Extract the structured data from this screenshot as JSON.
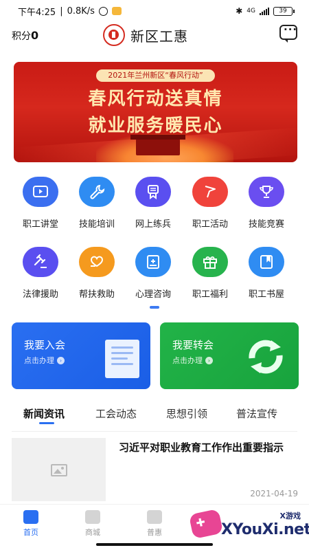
{
  "status_bar": {
    "time": "下午4:25",
    "speed": "0.8K/s",
    "network": "4G",
    "battery": "39"
  },
  "header": {
    "points_label": "积分",
    "points_value": "0",
    "title": "新区工惠"
  },
  "banner": {
    "tag": "2021年兰州新区“春风行动”",
    "line1": "春风行动送真情",
    "line2": "就业服务暖民心"
  },
  "grid": {
    "row1": [
      {
        "label": "职工讲堂",
        "icon": "video-play-icon",
        "color": "#3b6ff0"
      },
      {
        "label": "技能培训",
        "icon": "wrench-icon",
        "color": "#2f8cf2"
      },
      {
        "label": "网上练兵",
        "icon": "medal-icon",
        "color": "#5a4ff0"
      },
      {
        "label": "职工活动",
        "icon": "flag-icon",
        "color": "#f0433b"
      },
      {
        "label": "技能竞赛",
        "icon": "trophy-icon",
        "color": "#6a4ef0"
      }
    ],
    "row2": [
      {
        "label": "法律援助",
        "icon": "gavel-icon",
        "color": "#5a4ff0"
      },
      {
        "label": "帮扶救助",
        "icon": "heart-hand-icon",
        "color": "#f59a1e"
      },
      {
        "label": "心理咨询",
        "icon": "book-plus-icon",
        "color": "#2f8cf2"
      },
      {
        "label": "职工福利",
        "icon": "gift-icon",
        "color": "#27b34d"
      },
      {
        "label": "职工书屋",
        "icon": "bookmark-book-icon",
        "color": "#2f8cf2"
      }
    ]
  },
  "cards": {
    "join": {
      "title": "我要入会",
      "sub": "点击办理"
    },
    "transfer": {
      "title": "我要转会",
      "sub": "点击办理"
    }
  },
  "tabs": [
    "新闻资讯",
    "工会动态",
    "思想引领",
    "普法宣传"
  ],
  "news": {
    "title": "习近平对职业教育工作作出重要指示",
    "date": "2021-04-19"
  },
  "bottom_nav": [
    "首页",
    "商城",
    "普惠"
  ],
  "watermark": {
    "brand": "XYouXi.net",
    "small": "X游戏"
  },
  "colors": {
    "primary": "#2a6ff1",
    "green": "#1ea53f",
    "banner_red": "#d6281d"
  }
}
